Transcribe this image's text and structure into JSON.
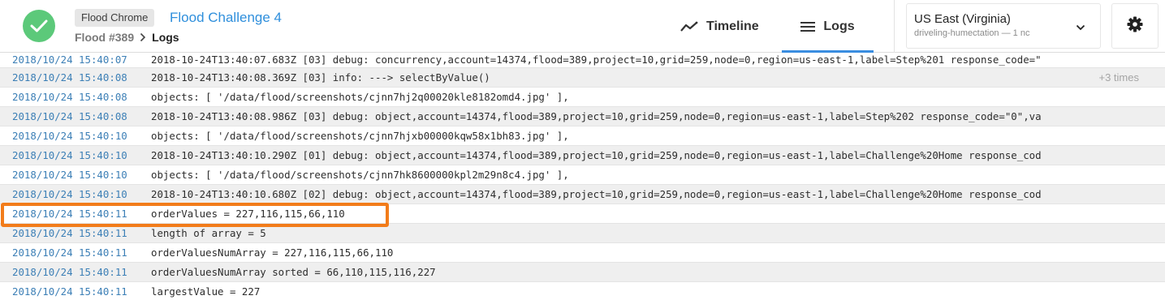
{
  "header": {
    "tool_badge": "Flood Chrome",
    "flood_title": "Flood Challenge 4",
    "breadcrumb_parent": "Flood #389",
    "breadcrumb_current": "Logs",
    "tabs": [
      {
        "label": "Timeline",
        "icon": "trend-line-icon",
        "active": false
      },
      {
        "label": "Logs",
        "icon": "list-icon",
        "active": true
      }
    ],
    "region": {
      "name": "US East (Virginia)",
      "subtitle": "driveling-humectation — 1 nc"
    },
    "accent_color": "#3a8de0",
    "status_color": "#5cc97a"
  },
  "logs": [
    {
      "ts": "2018/10/24 15:40:07",
      "msg": "2018-10-24T13:40:07.683Z [03] debug: concurrency,account=14374,flood=389,project=10,grid=259,node=0,region=us-east-1,label=Step%201 response_code=\"",
      "repeat": ""
    },
    {
      "ts": "2018/10/24 15:40:08",
      "msg": "2018-10-24T13:40:08.369Z [03] info: ---> selectByValue()",
      "repeat": "+3 times"
    },
    {
      "ts": "2018/10/24 15:40:08",
      "msg": "objects: [ '/data/flood/screenshots/cjnn7hj2q00020kle8182omd4.jpg' ],",
      "repeat": ""
    },
    {
      "ts": "2018/10/24 15:40:08",
      "msg": "2018-10-24T13:40:08.986Z [03] debug: object,account=14374,flood=389,project=10,grid=259,node=0,region=us-east-1,label=Step%202 response_code=\"0\",va",
      "repeat": ""
    },
    {
      "ts": "2018/10/24 15:40:10",
      "msg": "objects: [ '/data/flood/screenshots/cjnn7hjxb00000kqw58x1bh83.jpg' ],",
      "repeat": ""
    },
    {
      "ts": "2018/10/24 15:40:10",
      "msg": "2018-10-24T13:40:10.290Z [01] debug: object,account=14374,flood=389,project=10,grid=259,node=0,region=us-east-1,label=Challenge%20Home response_cod",
      "repeat": ""
    },
    {
      "ts": "2018/10/24 15:40:10",
      "msg": "objects: [ '/data/flood/screenshots/cjnn7hk8600000kpl2m29n8c4.jpg' ],",
      "repeat": ""
    },
    {
      "ts": "2018/10/24 15:40:10",
      "msg": "2018-10-24T13:40:10.680Z [02] debug: object,account=14374,flood=389,project=10,grid=259,node=0,region=us-east-1,label=Challenge%20Home response_cod",
      "repeat": ""
    },
    {
      "ts": "2018/10/24 15:40:11",
      "msg": "orderValues = 227,116,115,66,110",
      "repeat": ""
    },
    {
      "ts": "2018/10/24 15:40:11",
      "msg": "length of array = 5",
      "repeat": ""
    },
    {
      "ts": "2018/10/24 15:40:11",
      "msg": "orderValuesNumArray = 227,116,115,66,110",
      "repeat": ""
    },
    {
      "ts": "2018/10/24 15:40:11",
      "msg": "orderValuesNumArray sorted = 66,110,115,116,227",
      "repeat": ""
    },
    {
      "ts": "2018/10/24 15:40:11",
      "msg": "largestValue = 227",
      "repeat": ""
    }
  ],
  "highlight_color": "#f27c1a"
}
